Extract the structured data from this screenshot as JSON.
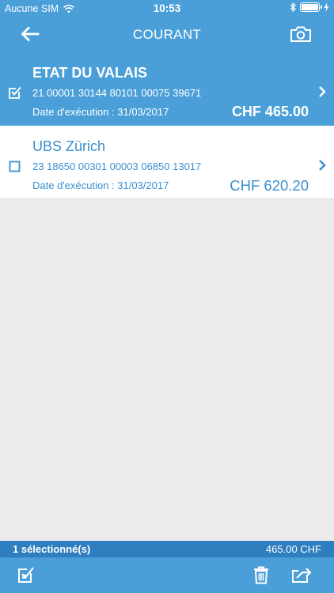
{
  "status_bar": {
    "carrier": "Aucune SIM",
    "time": "10:53"
  },
  "nav": {
    "title": "COURANT",
    "back_icon": "arrow-left-icon",
    "camera_icon": "camera-icon"
  },
  "payments": [
    {
      "name": "ETAT DU VALAIS",
      "account": "21 00001 30144 80101 00075 39671",
      "date": "Date d'exécution : 31/03/2017",
      "amount": "CHF 465.00",
      "selected": true
    },
    {
      "name": "UBS Zürich",
      "account": "23 18650 00301 00003 06850 13017",
      "date": "Date d'exécution : 31/03/2017",
      "amount": "CHF 620.20",
      "selected": false
    }
  ],
  "summary": {
    "selected_count": "1 sélectionné(s)",
    "total": "465.00 CHF"
  },
  "toolbar": {
    "select_icon": "checkbox-select-icon",
    "delete_icon": "trash-icon",
    "transfer_icon": "send-transfer-icon"
  },
  "colors": {
    "primary": "#4a9fd8",
    "summary_bar": "#2f7fc0",
    "background": "#ececec"
  }
}
